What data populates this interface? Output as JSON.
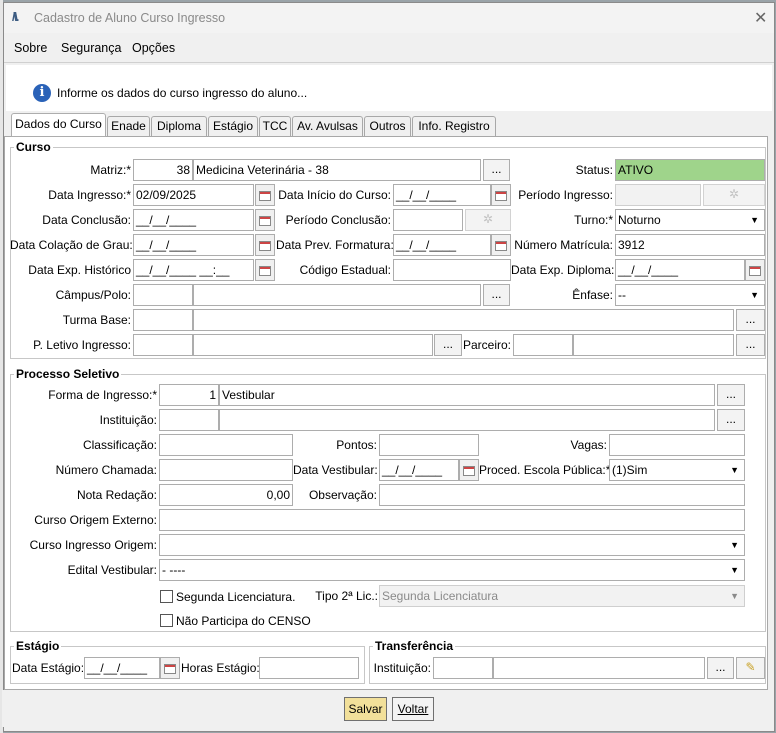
{
  "window": {
    "title": "Cadastro de Aluno Curso Ingresso",
    "close_glyph": "✕"
  },
  "menu": [
    "Sobre",
    "Segurança",
    "Opções"
  ],
  "info": {
    "text": "Informe os dados do curso ingresso do aluno...",
    "icon": "info-icon"
  },
  "tabs": [
    "Dados do Curso",
    "Enade",
    "Diploma",
    "Estágio",
    "TCC",
    "Av. Avulsas",
    "Outros",
    "Info. Registro"
  ],
  "curso": {
    "legend": "Curso",
    "matriz_label": "Matriz:*",
    "matriz_code": "38",
    "matriz_name": "Medicina Veterinária - 38",
    "status_label": "Status:",
    "status_value": "ATIVO",
    "data_ingresso_label": "Data Ingresso:*",
    "data_ingresso": "02/09/2025",
    "data_inicio_label": "Data Início do Curso:",
    "data_inicio": "__/__/____",
    "periodo_ingresso_label": "Período Ingresso:",
    "data_conclusao_label": "Data Conclusão:",
    "data_conclusao": "__/__/____",
    "periodo_conclusao_label": "Período Conclusão:",
    "turno_label": "Turno:*",
    "turno": "Noturno",
    "data_colacao_label": "Data Colação de Grau:",
    "data_colacao": "__/__/____",
    "data_prev_label": "Data Prev. Formatura:",
    "data_prev": "__/__/____",
    "numero_matricula_label": "Número Matrícula:",
    "numero_matricula": "3912",
    "data_exp_hist_label": "Data Exp. Histórico",
    "data_exp_hist": "__/__/____ __:__",
    "codigo_estadual_label": "Código Estadual:",
    "data_exp_diploma_label": "Data Exp. Diploma:",
    "data_exp_diploma": "__/__/____",
    "campus_label": "Câmpus/Polo:",
    "enfase_label": "Ênfase:",
    "enfase": "--",
    "turma_label": "Turma Base:",
    "p_letivo_label": "P. Letivo Ingresso:",
    "parceiro_label": "Parceiro:",
    "ellipsis": "..."
  },
  "processo": {
    "legend": "Processo Seletivo",
    "forma_label": "Forma de Ingresso:*",
    "forma_code": "1",
    "forma_name": "Vestibular",
    "instituicao_label": "Instituição:",
    "classificacao_label": "Classificação:",
    "pontos_label": "Pontos:",
    "vagas_label": "Vagas:",
    "numero_chamada_label": "Número Chamada:",
    "data_vestibular_label": "Data Vestibular:",
    "data_vestibular": "__/__/____",
    "proced_label": "Proced. Escola Pública:*",
    "proced": "(1)Sim",
    "nota_label": "Nota Redação:",
    "nota": "0,00",
    "observacao_label": "Observação:",
    "curso_origem_ext_label": "Curso Origem Externo:",
    "curso_ingresso_origem_label": "Curso Ingresso Origem:",
    "edital_label": "Edital Vestibular:",
    "edital": "- ----",
    "segunda_lic_label": "Segunda Licenciatura.",
    "tipo2_label": "Tipo 2ª Lic.:",
    "tipo2": "Segunda Licenciatura",
    "nao_participa_label": "Não Participa do CENSO"
  },
  "estagio": {
    "legend": "Estágio",
    "data_label": "Data Estágio:",
    "data": "__/__/____",
    "horas_label": "Horas Estágio:"
  },
  "transferencia": {
    "legend": "Transferência",
    "instituicao_label": "Instituição:"
  },
  "footer": {
    "salvar": "Salvar",
    "voltar": "Voltar"
  },
  "colors": {
    "status_green": "#9fd48b",
    "info_blue": "#2a62b8",
    "salvar_bg": "#f2e09a"
  }
}
